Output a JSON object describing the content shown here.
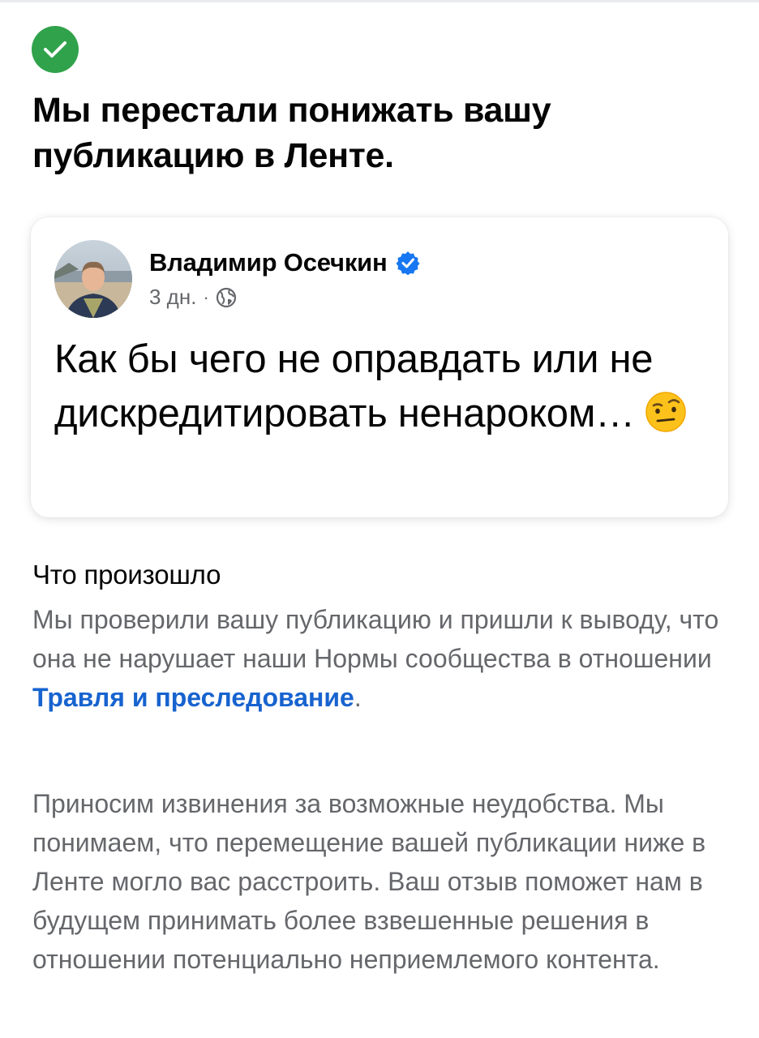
{
  "status": {
    "icon": "checkmark-icon",
    "color": "#31a24c",
    "headline": "Мы перестали понижать вашу публикацию в Ленте."
  },
  "post": {
    "author": "Владимир Осечкин",
    "verified_icon": "verified-badge-icon",
    "time": "3 дн.",
    "separator": "·",
    "audience_icon": "globe-icon",
    "text": "Как бы чего не оправдать или не дискредитировать ненароком…",
    "emoji": "face-with-raised-eyebrow"
  },
  "details": {
    "title": "Что произошло",
    "p1_before": "Мы проверили вашу публикацию и пришли к выводу, что она не нарушает наши Нормы сообщества в отношении ",
    "p1_link": "Травля и преследование",
    "p1_after": ".",
    "p2": "Приносим извинения за возможные неудобства. Мы понимаем, что перемещение вашей публикации ниже в Ленте могло вас расстроить. Ваш отзыв поможет нам в будущем принимать более взвешенные решения в отношении потенциально неприемлемого контента."
  },
  "colors": {
    "link": "#1763cf",
    "secondary_text": "#65676b",
    "verified": "#1877f2"
  }
}
